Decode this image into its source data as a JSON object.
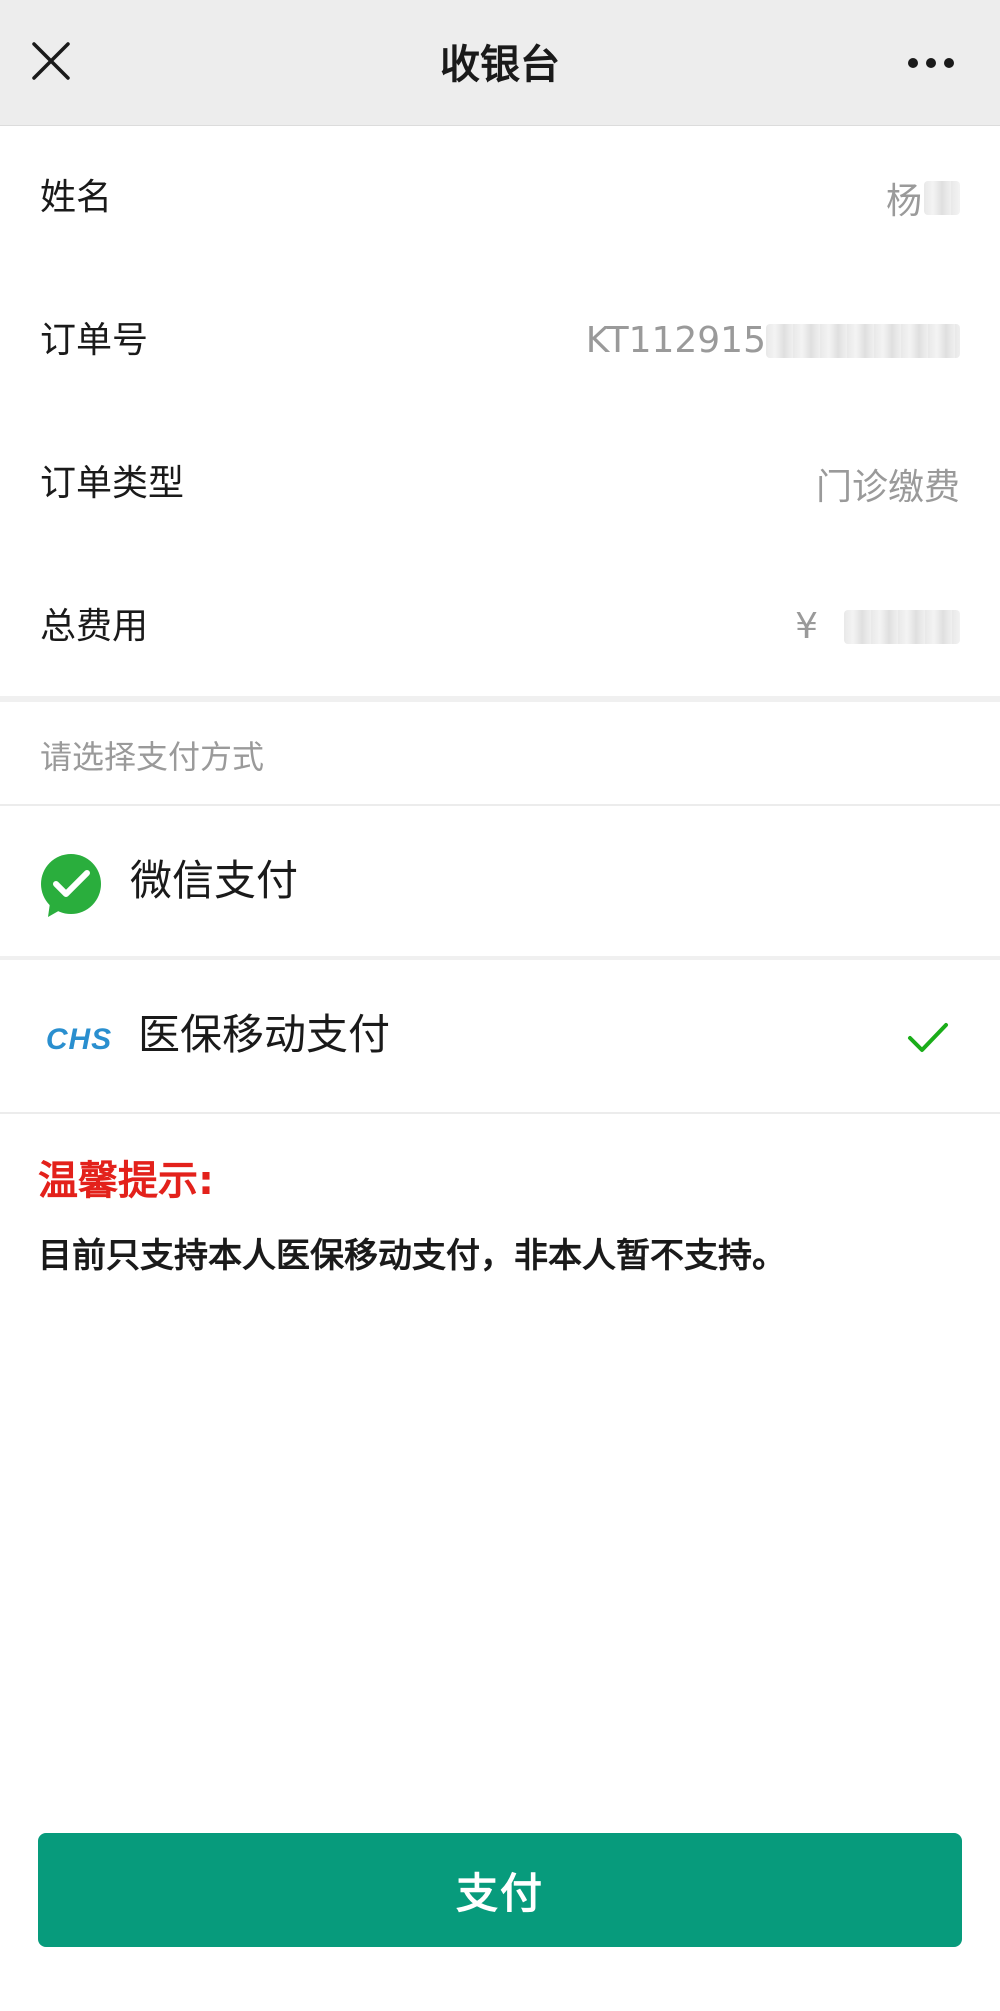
{
  "navbar": {
    "title": "收银台",
    "close_icon": "close-icon",
    "more_icon": "more-icon"
  },
  "info": {
    "name": {
      "label": "姓名",
      "value": "杨"
    },
    "order_no": {
      "label": "订单号",
      "value": "KT112915"
    },
    "order_type": {
      "label": "订单类型",
      "value": "门诊缴费"
    },
    "total": {
      "label": "总费用",
      "currency": "¥"
    }
  },
  "payment": {
    "prompt": "请选择支付方式",
    "options": [
      {
        "label": "微信支付",
        "icon": "wechat-pay-icon",
        "selected": false
      },
      {
        "label": "医保移动支付",
        "icon": "chs-logo",
        "logo_text": "CHS",
        "selected": true
      }
    ]
  },
  "tip": {
    "title": "温馨提示:",
    "body": "目前只支持本人医保移动支付，非本人暂不支持。"
  },
  "pay_button": {
    "label": "支付"
  },
  "colors": {
    "primary": "#079b7c",
    "wechat_green": "#2aae3d",
    "chs_blue": "#2a8fcf",
    "tip_red": "#e3211b",
    "check_green": "#1aad19"
  }
}
